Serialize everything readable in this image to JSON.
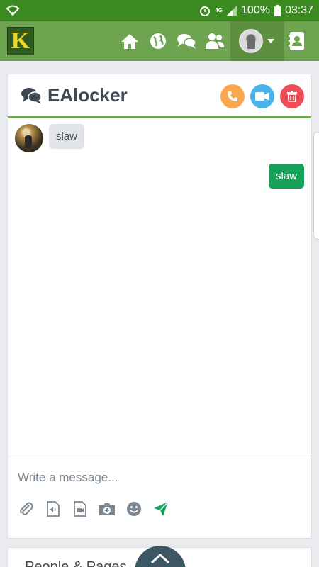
{
  "statusbar": {
    "battery": "100%",
    "time": "03:37",
    "network": "4G"
  },
  "chat": {
    "title": "EAlocker",
    "messages": [
      {
        "direction": "in",
        "text": "slaw"
      },
      {
        "direction": "out",
        "text": "slaw"
      }
    ],
    "composer": {
      "placeholder": "Write a message..."
    }
  },
  "next_card": {
    "title": "People & Pages"
  },
  "colors": {
    "statusbar": "#3a8a1f",
    "navbar": "#6ea34f",
    "accent_green": "#14a25a",
    "call": "#fba74f",
    "video": "#4ab3ec",
    "delete": "#ee4d55"
  },
  "icons": [
    "wifi-icon",
    "alarm-icon",
    "signal-icon",
    "battery-icon",
    "home-icon",
    "globe-icon",
    "chat-icon",
    "friends-icon",
    "contacts-icon",
    "phone-icon",
    "video-icon",
    "trash-icon",
    "attach-icon",
    "audio-file-icon",
    "video-file-icon",
    "camera-icon",
    "emoji-icon",
    "send-icon",
    "chevron-up-icon"
  ]
}
